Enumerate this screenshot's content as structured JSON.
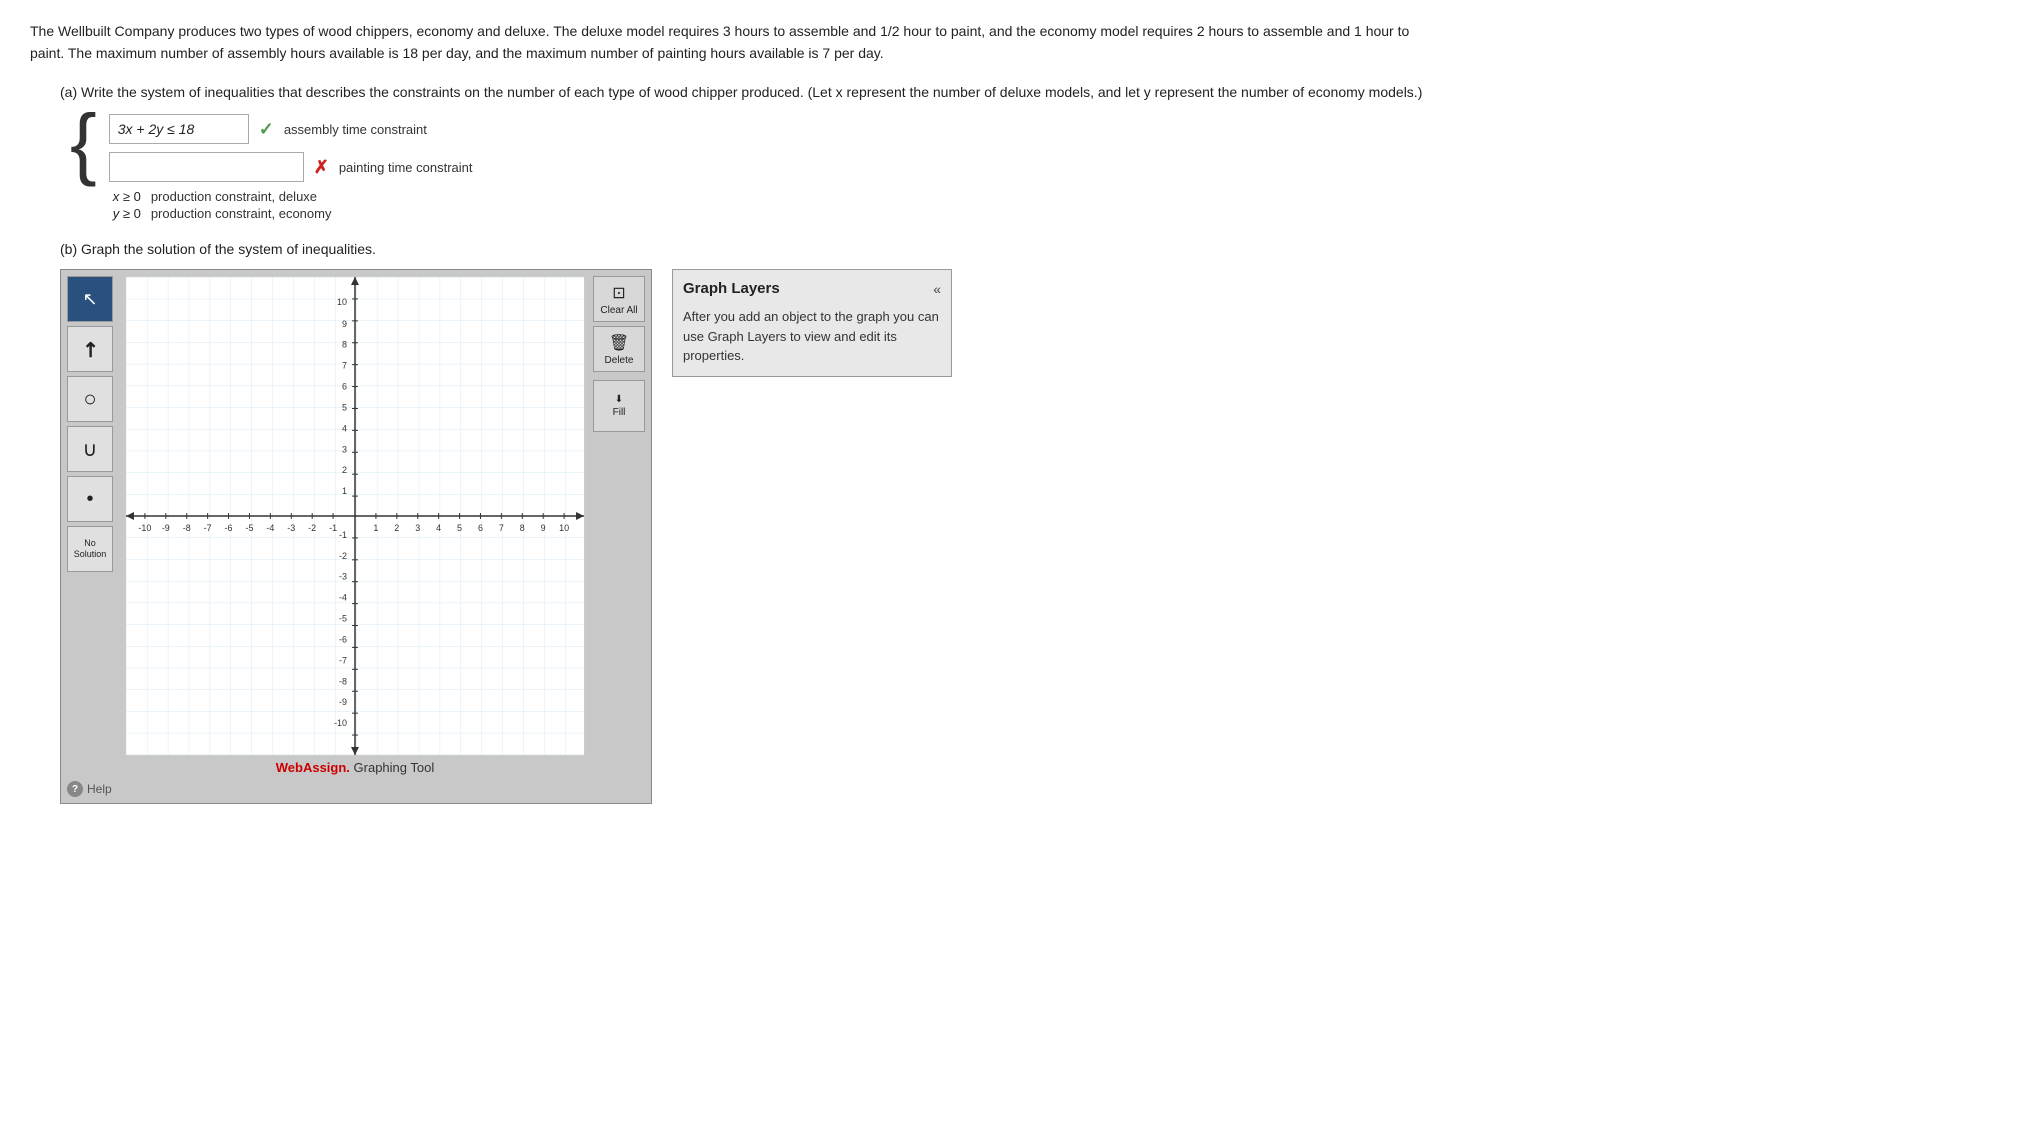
{
  "problem": {
    "text": "The Wellbuilt Company produces two types of wood chippers, economy and deluxe. The deluxe model requires 3 hours to assemble and 1/2 hour to paint, and the economy model requires 2 hours to assemble and 1 hour to paint. The maximum number of assembly hours available is 18 per day, and the maximum number of painting hours available is 7 per day.",
    "part_a_title": "(a) Write the system of inequalities that describes the constraints on the number of each type of wood chipper produced. (Let x represent the number of deluxe models, and let y represent the number of economy models.)",
    "part_b_title": "(b) Graph the solution of the system of inequalities.",
    "constraints": {
      "row1": {
        "equation": "3x + 2y ≤ 18",
        "label": "assembly time constraint",
        "status": "correct"
      },
      "row2": {
        "equation": "",
        "label": "painting time constraint",
        "status": "incorrect",
        "placeholder": ""
      },
      "row3_1": {
        "equation": "x ≥ 0",
        "label": "production constraint, deluxe"
      },
      "row3_2": {
        "equation": "y ≥ 0",
        "label": "production constraint, economy"
      }
    }
  },
  "toolbar": {
    "tools": [
      {
        "id": "select",
        "icon": "↖",
        "label": "Select",
        "active": true
      },
      {
        "id": "line",
        "icon": "↗",
        "label": "Line"
      },
      {
        "id": "circle",
        "icon": "○",
        "label": "Circle"
      },
      {
        "id": "curve",
        "icon": "∪",
        "label": "Curve"
      },
      {
        "id": "point",
        "icon": "•",
        "label": "Point"
      }
    ],
    "no_solution_label": "No Solution"
  },
  "side_buttons": [
    {
      "id": "clear-all",
      "icon": "⊡",
      "label": "Clear All"
    },
    {
      "id": "delete",
      "icon": "🗑",
      "label": "Delete"
    },
    {
      "id": "fill",
      "icon": "⬇",
      "label": "Fill"
    }
  ],
  "graph_layers": {
    "title": "Graph Layers",
    "collapse_icon": "«",
    "description": "After you add an object to the graph you can use Graph Layers to view and edit its properties."
  },
  "graph": {
    "x_min": -10,
    "x_max": 10,
    "y_min": -10,
    "y_max": 10,
    "x_labels": [
      "-10",
      "-9",
      "-8",
      "-7",
      "-6",
      "-5",
      "-4",
      "-3",
      "-2",
      "-1",
      "1",
      "2",
      "3",
      "4",
      "5",
      "6",
      "7",
      "8",
      "9",
      "10"
    ],
    "y_labels": [
      "-10",
      "-9",
      "-8",
      "-7",
      "-6",
      "-5",
      "-4",
      "-3",
      "-2",
      "-1",
      "1",
      "2",
      "3",
      "4",
      "5",
      "6",
      "7",
      "8",
      "9",
      "10"
    ]
  },
  "footer": {
    "brand": "WebAssign.",
    "text": " Graphing Tool"
  },
  "help_label": "Help"
}
